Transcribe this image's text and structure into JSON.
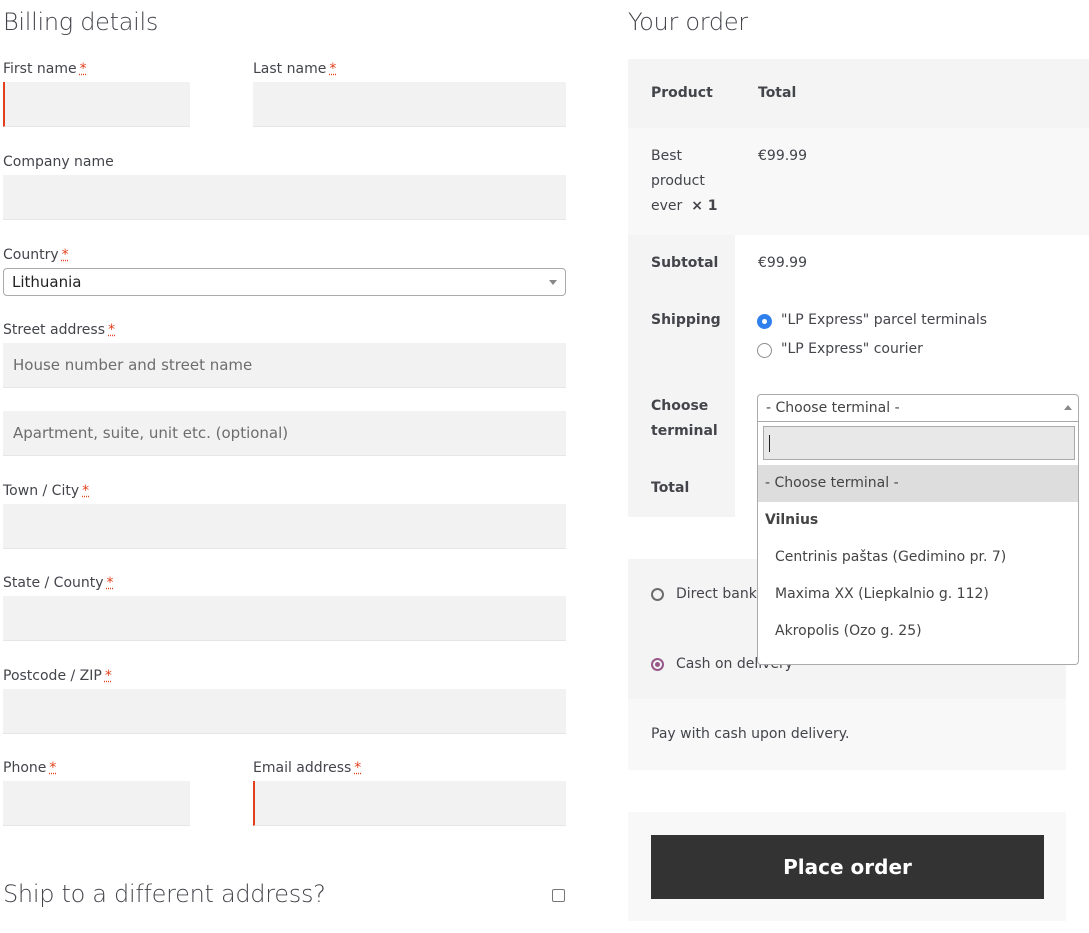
{
  "billing": {
    "title": "Billing details",
    "required_mark": "*",
    "first_name_label": "First name",
    "last_name_label": "Last name",
    "company_label": "Company name",
    "country_label": "Country",
    "country_value": "Lithuania",
    "street_label": "Street address",
    "street_placeholder": "House number and street name",
    "street2_placeholder": "Apartment, suite, unit etc. (optional)",
    "city_label": "Town / City",
    "state_label": "State / County",
    "postcode_label": "Postcode / ZIP",
    "phone_label": "Phone",
    "email_label": "Email address",
    "ship_different": "Ship to a different address?"
  },
  "order": {
    "title": "Your order",
    "col_product": "Product",
    "col_total": "Total",
    "product_line1": "Best",
    "product_line2": "product",
    "product_line3": "ever",
    "product_qty": "× 1",
    "product_price": "€99.99",
    "subtotal_label": "Subtotal",
    "subtotal_value": "€99.99",
    "shipping_label": "Shipping",
    "shipping_options": [
      "\"LP Express\" parcel terminals",
      "\"LP Express\" courier"
    ],
    "choose_label_1": "Choose",
    "choose_label_2": "terminal",
    "total_label": "Total",
    "terminal_selected": "- Choose terminal -",
    "terminal_options": {
      "placeholder": "- Choose terminal -",
      "group": "Vilnius",
      "items": [
        "Centrinis paštas (Gedimino pr. 7)",
        "Maxima XX (Liepkalnio g. 112)",
        "Akropolis (Ozo g. 25)"
      ]
    }
  },
  "payment": {
    "direct_bank": "Direct bank transfer",
    "cod": "Cash on delivery",
    "cod_desc": "Pay with cash upon delivery.",
    "place_order": "Place order"
  },
  "colors": {
    "required": "#e2401c",
    "radio_blue": "#2f80ed",
    "radio_purple": "#96588a",
    "button_bg": "#333333"
  }
}
